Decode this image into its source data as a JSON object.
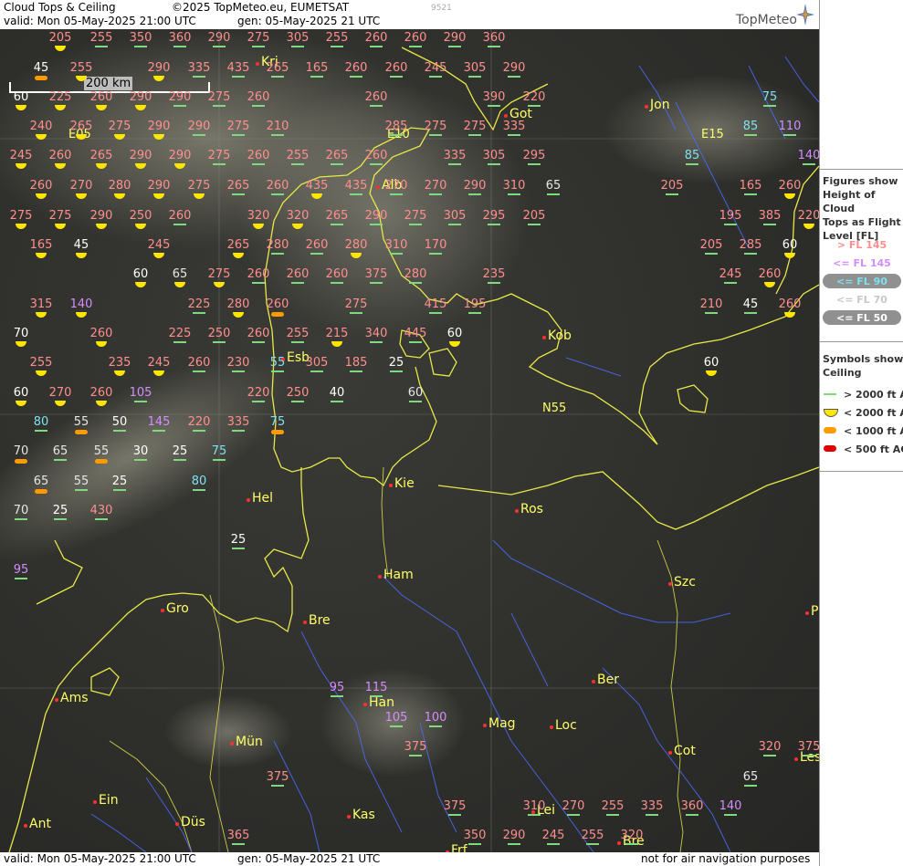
{
  "header": {
    "title": "Cloud Tops & Ceiling",
    "copyright": "©2025 TopMeteo.eu, EUMETSAT",
    "code": "9521",
    "valid": "valid:  Mon  05-May-2025  21:00 UTC",
    "gen": "gen: 05-May-2025 21 UTC",
    "brand": "TopMeteo"
  },
  "footer": {
    "valid": "valid:  Mon  05-May-2025  21:00 UTC",
    "gen": "gen: 05-May-2025 21 UTC",
    "disclaimer": "not for air navigation purposes"
  },
  "scale": {
    "label": "200 km"
  },
  "legend": {
    "figures_title": [
      "Figures show",
      "Height of Cloud",
      "Tops as Flight",
      "Level  [FL]"
    ],
    "figure_items": [
      {
        "label": "> FL 145",
        "color": "#ff8e8e",
        "oval": false
      },
      {
        "label": "<= FL 145",
        "color": "#d48cff",
        "oval": false
      },
      {
        "label": "<= FL 90",
        "color": "#7fe0ee",
        "oval": true
      },
      {
        "label": "<= FL 70",
        "color": "#c8c8c8",
        "oval": false
      },
      {
        "label": "<= FL 50",
        "color": "#ffffff",
        "oval": true
      }
    ],
    "symbols_title": [
      "Symbols show",
      "Ceiling"
    ],
    "symbol_items": [
      {
        "label": "> 2000 ft AGL",
        "type": "line",
        "color": "#7fd97f"
      },
      {
        "label": "< 2000 ft AGL",
        "type": "semi",
        "color": "#ffe600"
      },
      {
        "label": "< 1000 ft AGL",
        "type": "pill",
        "color": "#ff9a00"
      },
      {
        "label": "< 500 ft AGL",
        "type": "pill",
        "color": "#e00000"
      }
    ]
  },
  "grid_labels": [
    "E05",
    "E10",
    "E15",
    "N55"
  ],
  "cities": [
    "Kri",
    "Got",
    "Jon",
    "Alb",
    "Kob",
    "Esb",
    "Kie",
    "Ros",
    "Hel",
    "Ham",
    "Szc",
    "Gro",
    "Bre",
    "Ber",
    "Ams",
    "Han",
    "Mag",
    "Loc",
    "Mün",
    "Cot",
    "Les",
    "Ein",
    "Kas",
    "Lei",
    "Ant",
    "Düs",
    "Frf",
    "Bre",
    "P"
  ],
  "observations": [
    [
      "205",
      "high",
      "semi"
    ],
    [
      "255",
      "high",
      "line"
    ],
    [
      "350",
      "high",
      "line"
    ],
    [
      "360",
      "high",
      "line"
    ],
    [
      "290",
      "high",
      "line"
    ],
    [
      "275",
      "high",
      "line"
    ],
    [
      "305",
      "high",
      "line"
    ],
    [
      "255",
      "high",
      "line"
    ],
    [
      "260",
      "high",
      "line"
    ],
    [
      "260",
      "high",
      "line"
    ],
    [
      "290",
      "high",
      "line"
    ],
    [
      "360",
      "high",
      "line"
    ],
    [
      "45",
      "fifty",
      "pill"
    ],
    [
      "255",
      "high",
      "semi"
    ],
    [
      "290",
      "high",
      "semi"
    ],
    [
      "335",
      "high",
      "line"
    ],
    [
      "435",
      "high",
      "line"
    ],
    [
      "265",
      "high",
      "line"
    ],
    [
      "165",
      "high",
      "line"
    ],
    [
      "260",
      "high",
      "line"
    ],
    [
      "260",
      "high",
      "line"
    ],
    [
      "245",
      "high",
      "line"
    ],
    [
      "305",
      "high",
      "line"
    ],
    [
      "290",
      "high",
      "line"
    ],
    [
      "60",
      "fifty",
      "semi"
    ],
    [
      "225",
      "high",
      "semi"
    ],
    [
      "260",
      "high",
      "semi"
    ],
    [
      "290",
      "high",
      "semi"
    ],
    [
      "290",
      "high",
      "line"
    ],
    [
      "275",
      "high",
      "line"
    ],
    [
      "260",
      "high",
      "line"
    ],
    [
      "260",
      "high",
      "line"
    ],
    [
      "390",
      "high",
      "line"
    ],
    [
      "220",
      "high",
      "line"
    ],
    [
      "75",
      "low",
      "line"
    ],
    [
      "240",
      "high",
      "semi"
    ],
    [
      "265",
      "high",
      "semi"
    ],
    [
      "275",
      "high",
      "semi"
    ],
    [
      "290",
      "high",
      "semi"
    ],
    [
      "290",
      "high",
      "line"
    ],
    [
      "275",
      "high",
      "line"
    ],
    [
      "210",
      "high",
      "line"
    ],
    [
      "285",
      "high",
      "line"
    ],
    [
      "275",
      "high",
      "line"
    ],
    [
      "275",
      "high",
      "line"
    ],
    [
      "335",
      "high",
      "line"
    ],
    [
      "85",
      "low",
      "line"
    ],
    [
      "110",
      "mid",
      "line"
    ],
    [
      "245",
      "high",
      "semi"
    ],
    [
      "260",
      "high",
      "semi"
    ],
    [
      "265",
      "high",
      "semi"
    ],
    [
      "290",
      "high",
      "semi"
    ],
    [
      "290",
      "high",
      "semi"
    ],
    [
      "275",
      "high",
      "line"
    ],
    [
      "260",
      "high",
      "line"
    ],
    [
      "255",
      "high",
      "line"
    ],
    [
      "265",
      "high",
      "line"
    ],
    [
      "260",
      "high",
      "line"
    ],
    [
      "335",
      "high",
      "line"
    ],
    [
      "305",
      "high",
      "line"
    ],
    [
      "295",
      "high",
      "line"
    ],
    [
      "85",
      "low",
      "line"
    ],
    [
      "140",
      "mid",
      "line"
    ],
    [
      "260",
      "high",
      "semi"
    ],
    [
      "270",
      "high",
      "semi"
    ],
    [
      "280",
      "high",
      "semi"
    ],
    [
      "290",
      "high",
      "semi"
    ],
    [
      "275",
      "high",
      "semi"
    ],
    [
      "265",
      "high",
      "line"
    ],
    [
      "260",
      "high",
      "line"
    ],
    [
      "435",
      "high",
      "semi"
    ],
    [
      "435",
      "high",
      "line"
    ],
    [
      "270",
      "high",
      "line"
    ],
    [
      "270",
      "high",
      "line"
    ],
    [
      "290",
      "high",
      "line"
    ],
    [
      "310",
      "high",
      "line"
    ],
    [
      "65",
      "vlow",
      "line"
    ],
    [
      "205",
      "high",
      "line"
    ],
    [
      "165",
      "high",
      "line"
    ],
    [
      "260",
      "high",
      "semi"
    ],
    [
      "275",
      "high",
      "semi"
    ],
    [
      "275",
      "high",
      "semi"
    ],
    [
      "290",
      "high",
      "semi"
    ],
    [
      "250",
      "high",
      "semi"
    ],
    [
      "260",
      "high",
      "line"
    ],
    [
      "320",
      "high",
      "semi"
    ],
    [
      "320",
      "high",
      "semi"
    ],
    [
      "265",
      "high",
      "line"
    ],
    [
      "290",
      "high",
      "line"
    ],
    [
      "275",
      "high",
      "line"
    ],
    [
      "305",
      "high",
      "line"
    ],
    [
      "295",
      "high",
      "line"
    ],
    [
      "205",
      "high",
      "line"
    ],
    [
      "195",
      "high",
      "line"
    ],
    [
      "385",
      "high",
      "line"
    ],
    [
      "220",
      "high",
      "semi"
    ],
    [
      "165",
      "high",
      "semi"
    ],
    [
      "45",
      "fifty",
      "semi"
    ],
    [
      "245",
      "high",
      "semi"
    ],
    [
      "265",
      "high",
      "semi"
    ],
    [
      "280",
      "high",
      "line"
    ],
    [
      "260",
      "high",
      "line"
    ],
    [
      "280",
      "high",
      "semi"
    ],
    [
      "310",
      "high",
      "line"
    ],
    [
      "170",
      "high",
      "line"
    ],
    [
      "205",
      "high",
      "line"
    ],
    [
      "285",
      "high",
      "line"
    ],
    [
      "60",
      "fifty",
      "semi"
    ],
    [
      "60",
      "fifty",
      "semi"
    ],
    [
      "65",
      "vlow",
      "semi"
    ],
    [
      "275",
      "high",
      "semi"
    ],
    [
      "260",
      "high",
      "line"
    ],
    [
      "260",
      "high",
      "line"
    ],
    [
      "260",
      "high",
      "line"
    ],
    [
      "375",
      "high",
      "line"
    ],
    [
      "280",
      "high",
      "line"
    ],
    [
      "235",
      "high",
      "line"
    ],
    [
      "245",
      "high",
      "line"
    ],
    [
      "260",
      "high",
      "semi"
    ],
    [
      "315",
      "high",
      "semi"
    ],
    [
      "140",
      "mid",
      "semi"
    ],
    [
      "225",
      "high",
      "line"
    ],
    [
      "280",
      "high",
      "semi"
    ],
    [
      "260",
      "high",
      "pill"
    ],
    [
      "275",
      "high",
      "line"
    ],
    [
      "415",
      "high",
      "line"
    ],
    [
      "195",
      "high",
      "line"
    ],
    [
      "210",
      "high",
      "line"
    ],
    [
      "45",
      "fifty",
      "line"
    ],
    [
      "260",
      "high",
      "semi"
    ],
    [
      "70",
      "fifty",
      "semi"
    ],
    [
      "260",
      "high",
      "semi"
    ],
    [
      "225",
      "high",
      "line"
    ],
    [
      "250",
      "high",
      "line"
    ],
    [
      "260",
      "high",
      "line"
    ],
    [
      "255",
      "high",
      "line"
    ],
    [
      "215",
      "high",
      "semi"
    ],
    [
      "340",
      "high",
      "line"
    ],
    [
      "445",
      "high",
      "line"
    ],
    [
      "60",
      "fifty",
      "semi"
    ],
    [
      "255",
      "high",
      "semi"
    ],
    [
      "235",
      "high",
      "semi"
    ],
    [
      "245",
      "high",
      "semi"
    ],
    [
      "260",
      "high",
      "line"
    ],
    [
      "230",
      "high",
      "line"
    ],
    [
      "55",
      "low",
      "line"
    ],
    [
      "305",
      "high",
      "line"
    ],
    [
      "185",
      "high",
      "line"
    ],
    [
      "25",
      "fifty",
      "line"
    ],
    [
      "60",
      "fifty",
      "semi"
    ],
    [
      "60",
      "fifty",
      "semi"
    ],
    [
      "270",
      "high",
      "semi"
    ],
    [
      "260",
      "high",
      "semi"
    ],
    [
      "105",
      "mid",
      "line"
    ],
    [
      "220",
      "high",
      "line"
    ],
    [
      "250",
      "high",
      "line"
    ],
    [
      "40",
      "fifty",
      "line"
    ],
    [
      "60",
      "vlow",
      "line"
    ],
    [
      "80",
      "low",
      "line"
    ],
    [
      "55",
      "vlow",
      "pill"
    ],
    [
      "50",
      "fifty",
      "line"
    ],
    [
      "145",
      "mid",
      "line"
    ],
    [
      "220",
      "high",
      "line"
    ],
    [
      "335",
      "high",
      "line"
    ],
    [
      "75",
      "low",
      "pill"
    ],
    [
      "70",
      "vlow",
      "pill"
    ],
    [
      "65",
      "vlow",
      "line"
    ],
    [
      "55",
      "vlow",
      "pill"
    ],
    [
      "30",
      "fifty",
      "line"
    ],
    [
      "25",
      "fifty",
      "line"
    ],
    [
      "75",
      "low",
      "line"
    ],
    [
      "65",
      "vlow",
      "pill"
    ],
    [
      "55",
      "vlow",
      "line"
    ],
    [
      "25",
      "fifty",
      "line"
    ],
    [
      "80",
      "low",
      "line"
    ],
    [
      "70",
      "vlow",
      "line"
    ],
    [
      "25",
      "fifty",
      "line"
    ],
    [
      "430",
      "high",
      "line"
    ],
    [
      "25",
      "fifty",
      "line"
    ],
    [
      "95",
      "mid",
      "line"
    ],
    [
      "95",
      "mid",
      "line"
    ],
    [
      "115",
      "mid",
      "line"
    ],
    [
      "105",
      "mid",
      "line"
    ],
    [
      "100",
      "mid",
      "line"
    ],
    [
      "375",
      "high",
      "line"
    ],
    [
      "320",
      "high",
      "line"
    ],
    [
      "375",
      "high",
      "line"
    ],
    [
      "65",
      "vlow",
      "line"
    ],
    [
      "375",
      "high",
      "line"
    ],
    [
      "375",
      "high",
      "line"
    ],
    [
      "310",
      "high",
      "line"
    ],
    [
      "270",
      "high",
      "line"
    ],
    [
      "255",
      "high",
      "line"
    ],
    [
      "335",
      "high",
      "line"
    ],
    [
      "360",
      "high",
      "line"
    ],
    [
      "140",
      "mid",
      "line"
    ],
    [
      "365",
      "high",
      "line"
    ],
    [
      "350",
      "high",
      "line"
    ],
    [
      "290",
      "high",
      "line"
    ],
    [
      "245",
      "high",
      "line"
    ],
    [
      "255",
      "high",
      "line"
    ],
    [
      "320",
      "high",
      "line"
    ]
  ]
}
